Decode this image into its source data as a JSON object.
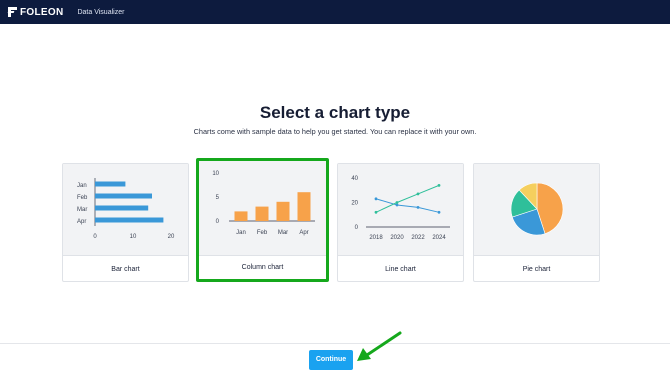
{
  "header": {
    "brand": "FOLEON",
    "app_title": "Data Visualizer"
  },
  "page": {
    "title": "Select a chart type",
    "subtitle": "Charts come with sample data to help you get started. You can replace it with your own."
  },
  "colors": {
    "header_bg": "#0d1b3e",
    "accent_blue": "#1aa2f0",
    "selected_border": "#15a81c",
    "bar_blue": "#3a98d8",
    "column_orange": "#f7a24a"
  },
  "cards": [
    {
      "label": "Bar chart",
      "selected": false,
      "icon": "bar-chart-thumbnail"
    },
    {
      "label": "Column chart",
      "selected": true,
      "icon": "column-chart-thumbnail"
    },
    {
      "label": "Line chart",
      "selected": false,
      "icon": "line-chart-thumbnail"
    },
    {
      "label": "Pie chart",
      "selected": false,
      "icon": "pie-chart-thumbnail"
    }
  ],
  "chart_data": [
    {
      "type": "bar",
      "orientation": "horizontal",
      "categories": [
        "Jan",
        "Feb",
        "Mar",
        "Apr"
      ],
      "values": [
        8,
        15,
        14,
        18
      ],
      "xlim": [
        0,
        20
      ],
      "x_ticks": [
        "0",
        "10",
        "20"
      ]
    },
    {
      "type": "bar",
      "orientation": "vertical",
      "categories": [
        "Jan",
        "Feb",
        "Mar",
        "Apr"
      ],
      "values": [
        2,
        3,
        4,
        6
      ],
      "ylim": [
        0,
        10
      ],
      "y_ticks": [
        "0",
        "5",
        "10"
      ]
    },
    {
      "type": "line",
      "x": [
        "2018",
        "2020",
        "2022",
        "2024"
      ],
      "series": [
        {
          "values": [
            23,
            18,
            16,
            12
          ],
          "color": "#3a98d8"
        },
        {
          "values": [
            12,
            20,
            27,
            34
          ],
          "color": "#2fbf9a"
        }
      ],
      "ylim": [
        0,
        40
      ],
      "y_ticks": [
        "0",
        "20",
        "40"
      ]
    },
    {
      "type": "pie",
      "values": [
        45,
        25,
        18,
        12
      ],
      "colors": [
        "#f7a24a",
        "#3a98d8",
        "#2fbf9a",
        "#f5cf5e"
      ]
    }
  ],
  "footer": {
    "continue_label": "Continue"
  }
}
